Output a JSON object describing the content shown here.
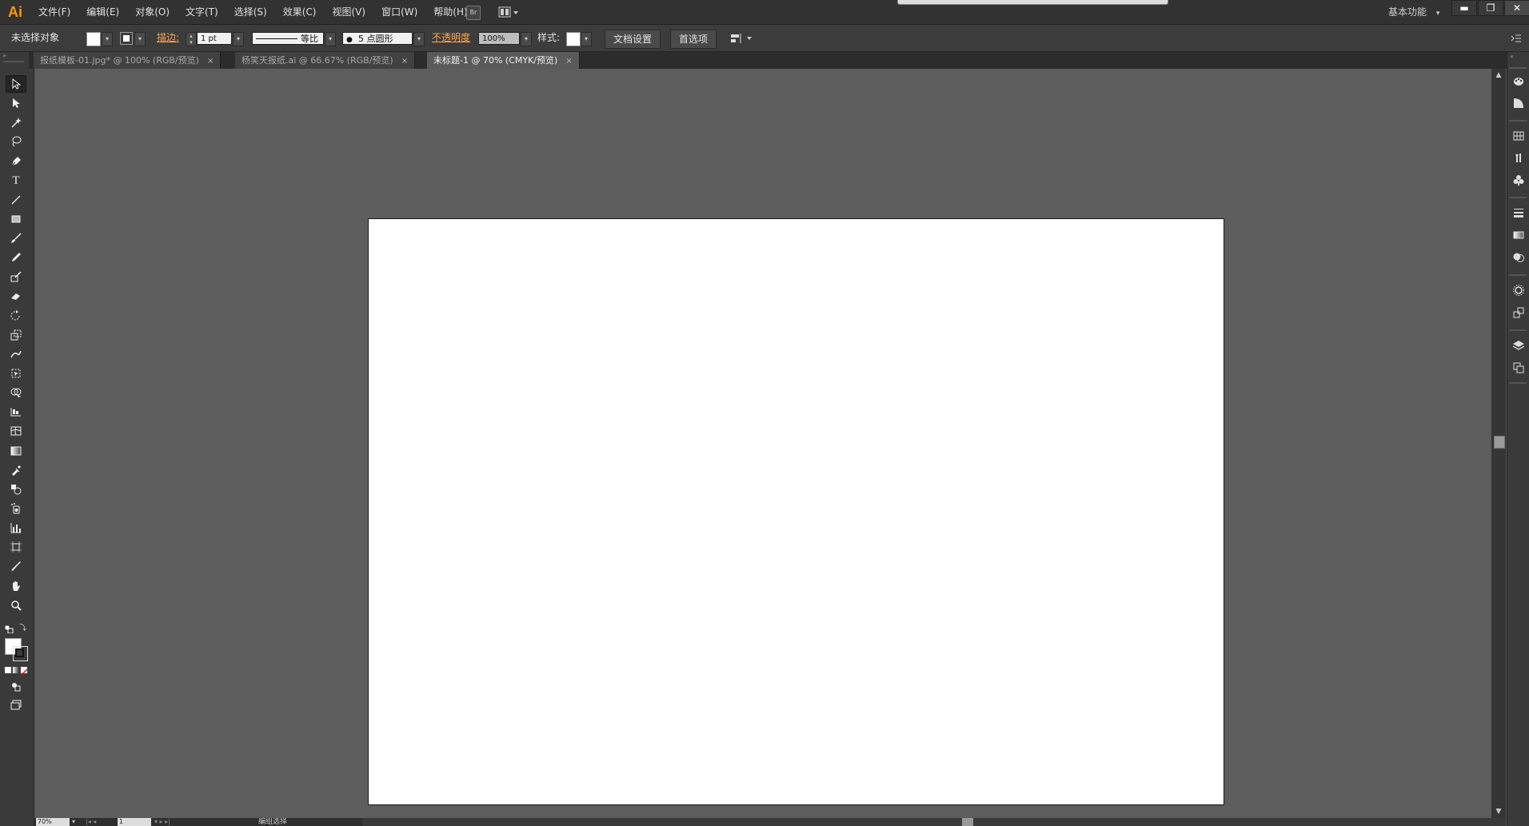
{
  "app": {
    "logo": "Ai",
    "menu": [
      "文件(F)",
      "编辑(E)",
      "对象(O)",
      "文字(T)",
      "选择(S)",
      "效果(C)",
      "视图(V)",
      "窗口(W)",
      "帮助(H)"
    ],
    "bridge_label": "Br",
    "workspace": "基本功能",
    "window_controls": {
      "minimize": "▬",
      "restore": "❐",
      "close": "✕"
    }
  },
  "controlbar": {
    "selection_status": "未选择对象",
    "stroke_label": "描边:",
    "stroke_weight": "1 pt",
    "stroke_profile": "等比",
    "brush": "5 点圆形",
    "opacity_label": "不透明度",
    "opacity_value": "100%",
    "style_label": "样式:",
    "doc_setup_button": "文档设置",
    "preferences_button": "首选项"
  },
  "tabs": [
    {
      "label": "报纸模板-01.jpg* @ 100% (RGB/预览)",
      "active": false
    },
    {
      "label": "杨笑天报纸.ai @ 66.67% (RGB/预览)",
      "active": false
    },
    {
      "label": "未标题-1 @ 70% (CMYK/预览)",
      "active": true
    }
  ],
  "tab_close_glyph": "×",
  "statusbar": {
    "zoom": "70%",
    "artboard_number": "1",
    "status_text": "编组选择"
  },
  "colors": {
    "accent": "#ff9a00",
    "link": "#ffa64d",
    "canvas": "#5d5d5d",
    "artboard": "#ffffff"
  }
}
